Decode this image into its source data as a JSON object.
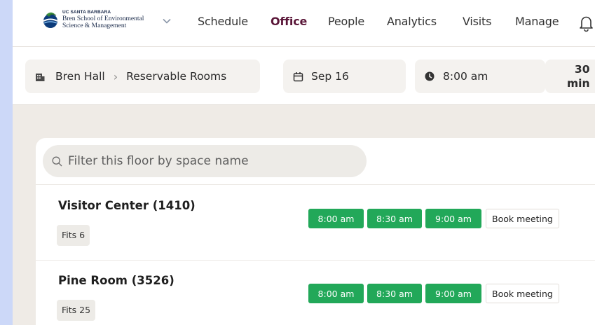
{
  "brand": {
    "university": "UC SANTA BARBARA",
    "line1": "Bren School of Environmental",
    "line2": "Science & Management",
    "logo_icon": "bren-school-logo",
    "dropdown_icon": "chevron-down-icon"
  },
  "nav": {
    "items": [
      {
        "label": "Schedule",
        "active": false
      },
      {
        "label": "Office",
        "active": true
      },
      {
        "label": "People",
        "active": false
      },
      {
        "label": "Analytics",
        "active": false
      },
      {
        "label": "Visits",
        "active": false
      },
      {
        "label": "Manage",
        "active": false
      }
    ],
    "notifications_icon": "bell-icon",
    "active_color": "#5a1638"
  },
  "subbar": {
    "building": "Bren Hall",
    "building_icon": "building-icon",
    "separator": "›",
    "area": "Reservable Rooms",
    "date": "Sep 16",
    "date_icon": "calendar-icon",
    "time": "8:00 am",
    "time_icon": "clock-icon",
    "duration_value": "30",
    "duration_unit": "min"
  },
  "search": {
    "placeholder": "Filter this floor by space name",
    "value": "",
    "icon": "search-icon"
  },
  "rooms": [
    {
      "name": "Visitor Center (1410)",
      "capacity": "Fits 6",
      "slots": [
        "8:00 am",
        "8:30 am",
        "9:00 am"
      ],
      "book_label": "Book meeting"
    },
    {
      "name": "Pine Room (3526)",
      "capacity": "Fits 25",
      "slots": [
        "8:00 am",
        "8:30 am",
        "9:00 am"
      ],
      "book_label": "Book meeting"
    }
  ],
  "colors": {
    "slot_available": "#22a859",
    "page_background": "#efebe6",
    "window_background": "#ccd8f8"
  }
}
